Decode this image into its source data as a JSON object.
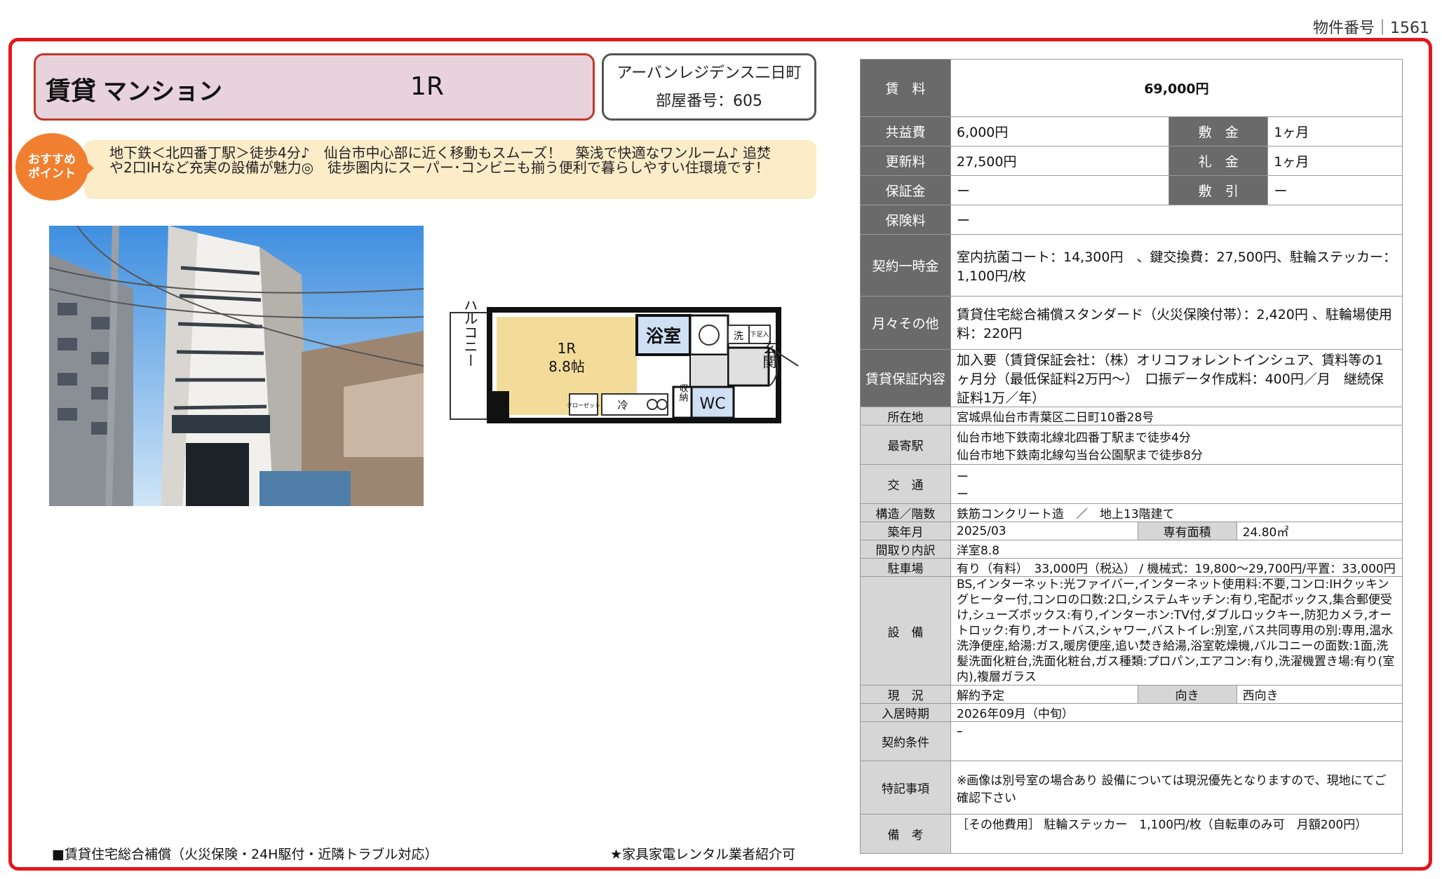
{
  "header": {
    "property_number": "物件番号｜1561"
  },
  "title": {
    "type": "賃貸",
    "kind": "マンション",
    "layout": "1R"
  },
  "building": {
    "name": "アーバンレジデンス二日町",
    "room": "部屋番号：605"
  },
  "recommend": {
    "badge_line1": "おすすめ",
    "badge_line2": "ポイント",
    "text": "地下鉄＜北四番丁駅＞徒歩4分♪　仙台市中心部に近く移動もスムーズ！　築浅で快適なワンルーム♪ 追焚や2口IHなど充実の設備が魅力◎　徒歩圏内にスーパー･コンビニも揃う便利で暮らしやすい住環境です！"
  },
  "floorplan": {
    "balcony": "バルコニー",
    "room_type": "1R",
    "room_size": "8.8帖",
    "bath": "浴室",
    "washer": "洗",
    "shoe": "下足入",
    "entrance": "玄関",
    "storage": "収納",
    "wc": "WC",
    "closet": "クローゼット",
    "fridge": "冷"
  },
  "rent": {
    "rent_label": "賃　料",
    "rent_value": "69,000円",
    "common_label": "共益費",
    "common_value": "6,000円",
    "deposit_label": "敷　金",
    "deposit_value": "1ヶ月",
    "renewal_label": "更新料",
    "renewal_value": "27,500円",
    "key_money_label": "礼　金",
    "key_money_value": "1ヶ月",
    "guarantee_label": "保証金",
    "guarantee_value": "ー",
    "deduction_label": "敷　引",
    "deduction_value": "ー",
    "insurance_label": "保険料",
    "insurance_value": "ー",
    "onetime_label": "契約一時金",
    "onetime_value": "室内抗菌コート：14,300円　、鍵交換費：27,500円、駐輪ステッカー：1,100円/枚",
    "monthly_label": "月々その他",
    "monthly_value": "賃貸住宅総合補償スタンダード（火災保険付帯）：2,420円 、駐輪場使用料：220円",
    "guarantor_label": "賃貸保証内容",
    "guarantor_value": "加入要（賃貸保証会社：（株）オリコフォレントインシュア、賃料等の1ヶ月分（最低保証料2万円～）　口振データ作成料：400円／月　継続保証料1万／年）"
  },
  "info": {
    "address_label": "所在地",
    "address_value": "宮城県仙台市青葉区二日町10番28号",
    "station_label": "最寄駅",
    "station_value1": "仙台市地下鉄南北線北四番丁駅まで徒歩4分",
    "station_value2": "仙台市地下鉄南北線勾当台公園駅まで徒歩8分",
    "transport_label": "交　通",
    "transport_value1": "ー",
    "transport_value2": "ー",
    "structure_label": "構造／階数",
    "structure_value": "鉄筋コンクリート造　／　地上13階建て",
    "built_label": "築年月",
    "built_value": "2025/03",
    "area_label": "専有面積",
    "area_value": "24.80㎡",
    "rooms_label": "間取り内訳",
    "rooms_value": "洋室8.8",
    "parking_label": "駐車場",
    "parking_value": "有り（有料）　33,000円（税込） / 機械式：19,800～29,700円/平置：33,000円",
    "equipment_label": "設　備",
    "equipment_value": "BS,インターネット:光ファイバー,インターネット使用料:不要,コンロ:IHクッキングヒーター付,コンロの口数:2口,システムキッチン:有り,宅配ボックス,集合郵便受け,シューズボックス:有り,インターホン:TV付,ダブルロックキー,防犯カメラ,オートロック:有り,オートバス,シャワー,バストイレ:別室,バス共同専用の別:専用,温水洗浄便座,給湯:ガス,暖房便座,追い焚き給湯,浴室乾燥機,バルコニーの面数:1面,洗髪洗面化粧台,洗面化粧台,ガス種類:プロパン,エアコン:有り,洗濯機置き場:有り(室内),複層ガラス",
    "status_label": "現　況",
    "status_value": "解約予定",
    "direction_label": "向き",
    "direction_value": "西向き",
    "movein_label": "入居時期",
    "movein_value": "2026年09月（中旬）",
    "conditions_label": "契約条件",
    "conditions_value": "ｰ",
    "special_label": "特記事項",
    "special_value": "※画像は別号室の場合あり 設備については現況優先となりますので、現地にてご確認下さい",
    "remarks_label": "備　考",
    "remarks_value": "［その他費用］ 駐輪ステッカー　1,100円/枚（自転車のみ可　月額200円）"
  },
  "footer": {
    "left": "■賃貸住宅総合補償（火災保険・24H駆付・近隣トラブル対応）",
    "right": "★家具家電レンタル業者紹介可"
  },
  "colors": {
    "accent": "#e3161b",
    "rent_value": "#d0161b",
    "badge": "#f08030",
    "title_bg": "#e8d2dc",
    "rec_bg": "#fcecc8"
  }
}
